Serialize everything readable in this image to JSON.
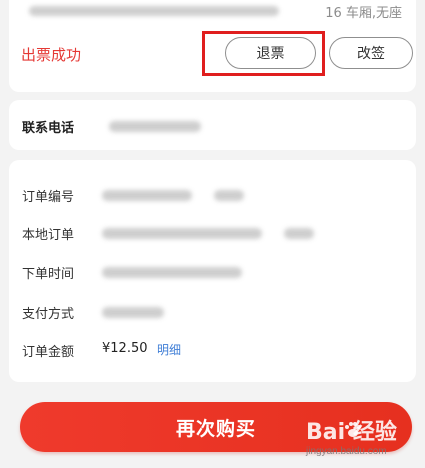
{
  "ticket": {
    "seat_info": "16 车厢,无座",
    "status": "出票成功",
    "refund_label": "退票",
    "change_label": "改签"
  },
  "contact": {
    "phone_label": "联系电话"
  },
  "order": {
    "rows": [
      {
        "label": "订单编号"
      },
      {
        "label": "本地订单"
      },
      {
        "label": "下单时间"
      },
      {
        "label": "支付方式"
      }
    ],
    "amount_label": "订单金额",
    "amount_value": "¥12.50",
    "detail_link": "明细"
  },
  "footer": {
    "rebuy_label": "再次购买"
  },
  "watermark": {
    "main": "Bai 经验",
    "sub": "jingyan.baidu.com"
  },
  "colors": {
    "accent_red": "#e53935",
    "button_red": "#ef3a2c",
    "highlight_red": "#e01e1e",
    "link_blue": "#3f7ed6"
  }
}
